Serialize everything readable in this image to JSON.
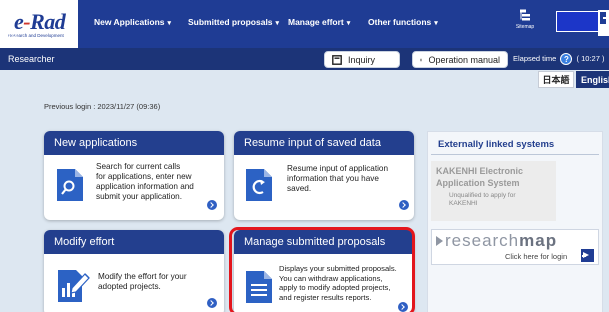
{
  "app": {
    "logo_text": "e-Rad",
    "logo_subtitle": "Research and Development"
  },
  "nav": {
    "items": [
      {
        "label": "New Applications"
      },
      {
        "label": "Submitted proposals"
      },
      {
        "label": "Manage effort"
      },
      {
        "label": "Other functions"
      }
    ],
    "sitemap_label": "Sitemap",
    "logout_label": "Logout"
  },
  "subheader": {
    "role": "Researcher",
    "inquiry_label": "Inquiry",
    "manual_label": "Operation manual",
    "elapsed_label": "Elapsed time",
    "elapsed_value": "( 10:27 )"
  },
  "language": {
    "japanese": "日本語",
    "english": "English"
  },
  "previous_login": "Previous login : 2023/11/27 (09:36)",
  "cards": [
    {
      "title": "New applications",
      "description": [
        "Search for current calls",
        "for applications, enter new",
        "application information and",
        "submit your application."
      ],
      "icon": "search-document-icon"
    },
    {
      "title": "Resume input of saved data",
      "description": [
        "Resume input of application",
        "information that you have",
        "saved."
      ],
      "icon": "resume-document-icon"
    },
    {
      "title": "Modify effort",
      "description": [
        "Modify the effort for your",
        "adopted projects."
      ],
      "icon": "edit-chart-icon"
    },
    {
      "title": "Manage submitted proposals",
      "description": [
        "Displays your submitted proposals.",
        "You can withdraw applications,",
        "apply to modify adopted projects,",
        "and register results reports."
      ],
      "icon": "document-icon"
    }
  ],
  "external": {
    "title": "Externally linked systems",
    "kakenhi_title": [
      "KAKENHI Electronic",
      "Application System"
    ],
    "kakenhi_note": [
      "Unqualified to apply for",
      "KAKENHI"
    ],
    "researchmap_logo_light": "research",
    "researchmap_logo_bold": "map",
    "researchmap_login": "Click here for login"
  },
  "colors": {
    "nav_bg": "#1f3c94",
    "subbar_bg": "#1c3478",
    "card_header": "#233f8e",
    "highlight": "#e3161d",
    "page_bg": "#dde7f1"
  }
}
